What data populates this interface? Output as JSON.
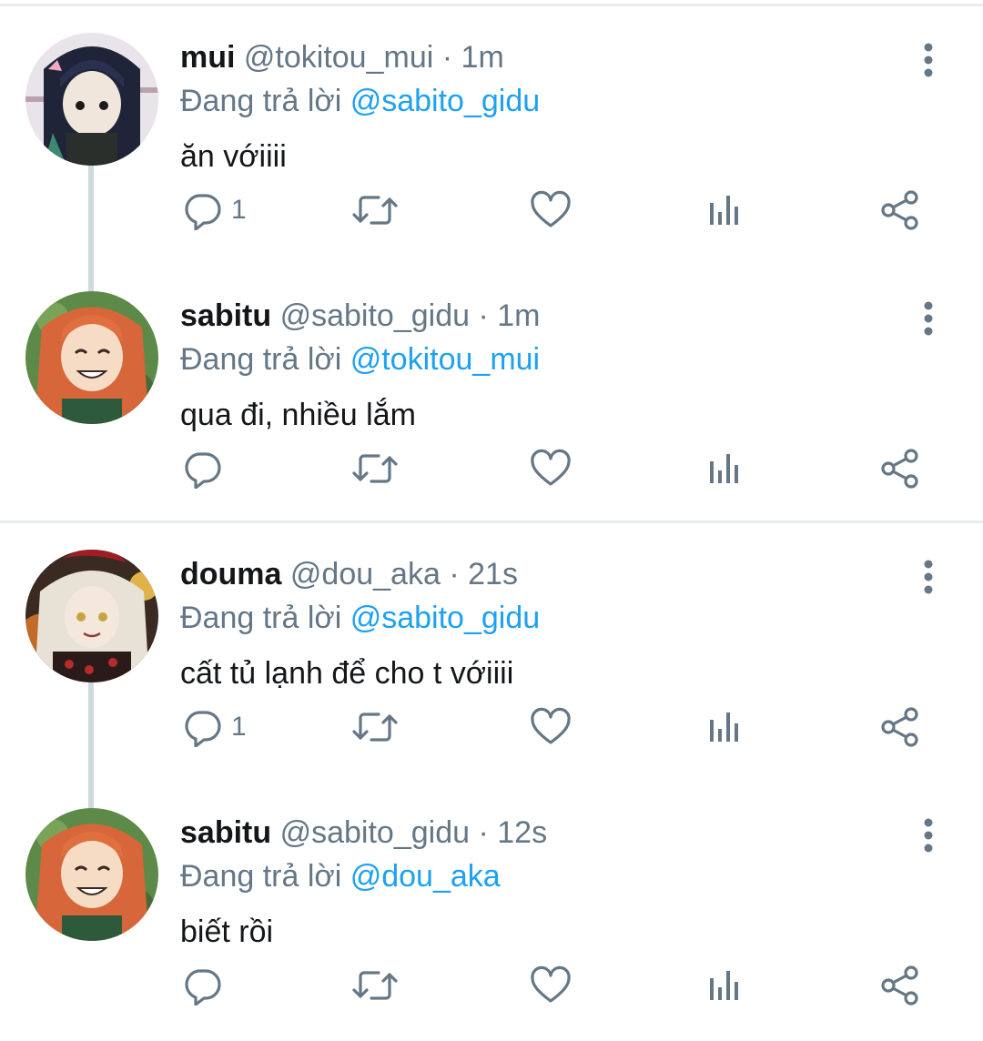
{
  "accent": "#1da1f2",
  "muted_color": "#657786",
  "tweets": [
    {
      "name": "mui",
      "handle": "@tokitou_mui",
      "dot": "·",
      "time": "1m",
      "replying_prefix": "Đang trả lời",
      "replying_to": "@sabito_gidu",
      "text": "ăn vớiiii",
      "reply_count": "1",
      "avatar": "dark-haired-character-avatar"
    },
    {
      "name": "sabitu",
      "handle": "@sabito_gidu",
      "dot": "·",
      "time": "1m",
      "replying_prefix": "Đang trả lời",
      "replying_to": "@tokitou_mui",
      "text": "qua đi, nhiều lắm",
      "reply_count": "",
      "avatar": "orange-haired-character-avatar"
    },
    {
      "name": "douma",
      "handle": "@dou_aka",
      "dot": "·",
      "time": "21s",
      "replying_prefix": "Đang trả lời",
      "replying_to": "@sabito_gidu",
      "text": "cất tủ lạnh để cho t vớiiii",
      "reply_count": "1",
      "avatar": "white-haired-character-avatar"
    },
    {
      "name": "sabitu",
      "handle": "@sabito_gidu",
      "dot": "·",
      "time": "12s",
      "replying_prefix": "Đang trả lời",
      "replying_to": "@dou_aka",
      "text": "biết rồi",
      "reply_count": "",
      "avatar": "orange-haired-character-avatar"
    }
  ],
  "icons": {
    "reply": "reply-icon",
    "retweet": "retweet-icon",
    "like": "heart-icon",
    "analytics": "analytics-icon",
    "share": "share-icon",
    "more": "more-vertical-icon"
  }
}
